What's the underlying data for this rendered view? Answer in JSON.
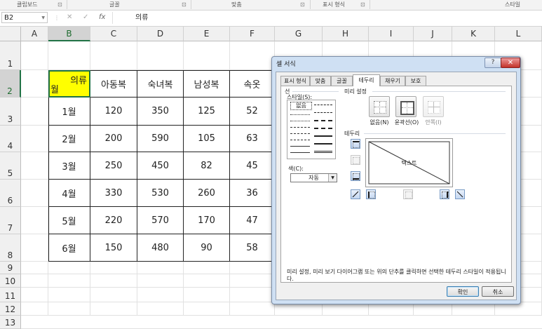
{
  "ribbon": {
    "groups": [
      "클립보드",
      "글꼴",
      "맞춤",
      "표시 형식",
      "스타일"
    ],
    "launcher_glyph": "⊡"
  },
  "formula_bar": {
    "name_box": "B2",
    "cancel_glyph": "✕",
    "enter_glyph": "✓",
    "fx_glyph": "fx",
    "value": "의류"
  },
  "sheet": {
    "columns": [
      "A",
      "B",
      "C",
      "D",
      "E",
      "F",
      "G",
      "H",
      "I",
      "J",
      "K",
      "L"
    ],
    "rows": [
      "1",
      "2",
      "3",
      "4",
      "5",
      "6",
      "7",
      "8",
      "9",
      "10",
      "11",
      "12",
      "13"
    ],
    "selected_column": "B",
    "selected_row": "2",
    "table": {
      "b2_top_right": "의류",
      "b2_bottom_left": "월",
      "fill_color": "#ffff00",
      "headers": [
        "아동복",
        "숙녀복",
        "남성복",
        "속옷"
      ],
      "months": [
        "1월",
        "2월",
        "3월",
        "4월",
        "5월",
        "6월"
      ],
      "values": [
        [
          "120",
          "350",
          "125",
          "52"
        ],
        [
          "200",
          "590",
          "105",
          "63"
        ],
        [
          "250",
          "450",
          "82",
          "45"
        ],
        [
          "330",
          "530",
          "260",
          "36"
        ],
        [
          "220",
          "570",
          "170",
          "47"
        ],
        [
          "150",
          "480",
          "90",
          "58"
        ]
      ]
    }
  },
  "dialog": {
    "title": "셀 서식",
    "help_label": "?",
    "close_label": "✕",
    "tabs": [
      "표시 형식",
      "맞춤",
      "글꼴",
      "테두리",
      "채우기",
      "보호"
    ],
    "active_tab": "테두리",
    "line_group": "선",
    "style_label": "스타일(S):",
    "none_style": "없음",
    "color_label": "색(C):",
    "color_value": "자동",
    "presets_group": "미리 설정",
    "presets": [
      "없음(N)",
      "윤곽선(O)",
      "안쪽(I)"
    ],
    "border_group": "테두리",
    "preview_text": "텍스트",
    "info": "미리 설정, 미리 보기 다이어그램 또는 위의 단추를 클릭하면 선택한 테두리 스타일이 적용됩니다.",
    "ok_label": "확인",
    "cancel_label": "취소"
  }
}
